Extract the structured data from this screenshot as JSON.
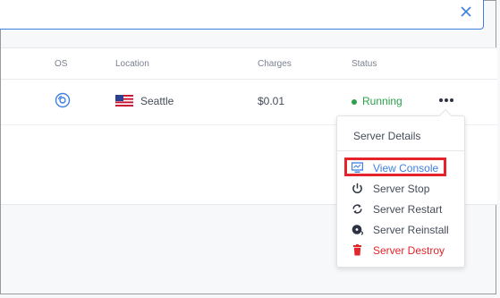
{
  "table": {
    "headers": {
      "os": "OS",
      "location": "Location",
      "charges": "Charges",
      "status": "Status"
    },
    "row": {
      "location": "Seattle",
      "charges": "$0.01",
      "status": "Running"
    }
  },
  "menu": {
    "header": "Server Details",
    "items": [
      {
        "label": "View Console",
        "icon": "monitor-icon"
      },
      {
        "label": "Server Stop",
        "icon": "power-icon"
      },
      {
        "label": "Server Restart",
        "icon": "restart-icon"
      },
      {
        "label": "Server Reinstall",
        "icon": "disc-icon"
      },
      {
        "label": "Server Destroy",
        "icon": "trash-icon"
      }
    ]
  },
  "colors": {
    "accent": "#3f7fe0",
    "running": "#2aa14a",
    "danger": "#e2262b",
    "highlight": "#e5232a"
  }
}
